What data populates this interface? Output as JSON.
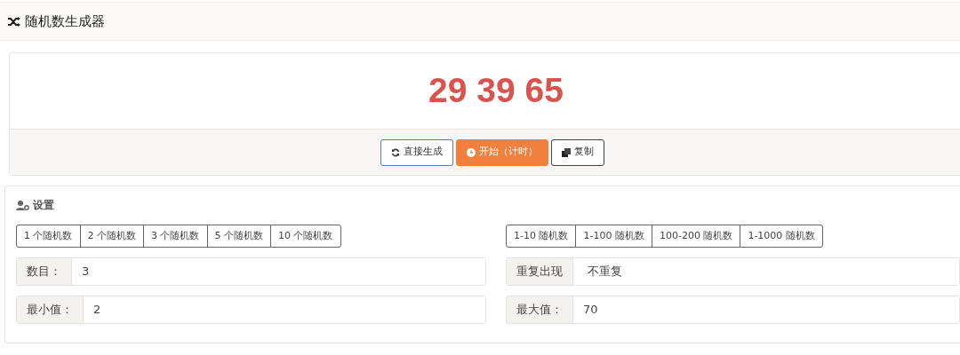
{
  "header": {
    "title": "随机数生成器"
  },
  "result": {
    "numbers": "29 39 65"
  },
  "actions": [
    {
      "label": "直接生成",
      "kind": "outline"
    },
    {
      "label": "开始（计时）",
      "kind": "primary"
    },
    {
      "label": "复制",
      "kind": "dark"
    }
  ],
  "settings": {
    "title": "设置",
    "count_presets": [
      "1 个随机数",
      "2 个随机数",
      "3 个随机数",
      "5 个随机数",
      "10 个随机数"
    ],
    "range_presets": [
      "1-10 随机数",
      "1-100 随机数",
      "100-200 随机数",
      "1-1000 随机数"
    ],
    "left_fields": [
      {
        "label": "数目：",
        "value": "3",
        "kind": "input"
      },
      {
        "label": "最小值：",
        "value": "2",
        "kind": "input"
      }
    ],
    "right_fields": [
      {
        "label": "重复出现",
        "value": "不重复",
        "kind": "select"
      },
      {
        "label": "最大值：",
        "value": "70",
        "kind": "input"
      }
    ]
  }
}
